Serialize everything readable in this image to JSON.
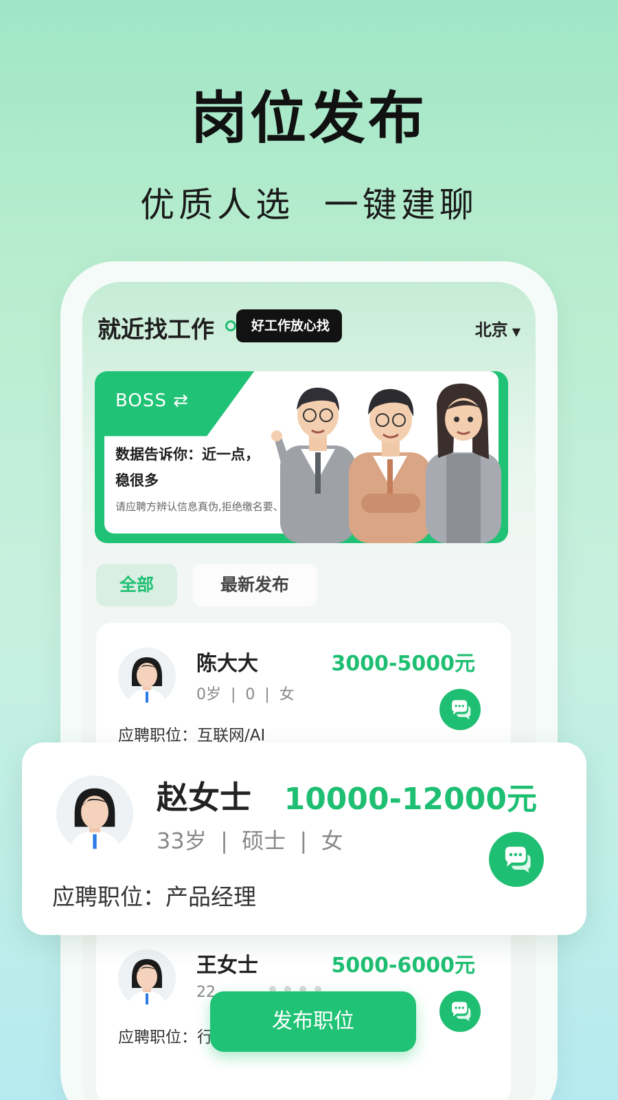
{
  "promo": {
    "headline": "岗位发布",
    "subheadline": "优质人选  一键建聊"
  },
  "app": {
    "title": "就近找工作",
    "slogan": "好工作放心找",
    "city": "北京"
  },
  "banner": {
    "tag": "BOSS ⇄",
    "title": "数据告诉你：近一点，稳很多",
    "note": "请应聘方辨认信息真伪,拒绝缴名要、押金等要求,谨防上当受骗"
  },
  "tabs": [
    {
      "label": "全部",
      "active": true
    },
    {
      "label": "最新发布",
      "active": false
    }
  ],
  "candidates": [
    {
      "name": "陈大大",
      "salary": "3000-5000元",
      "meta": "0岁  |  0  |  女",
      "position": "应聘职位：互联网/AI"
    },
    {
      "name": "赵女士",
      "salary": "10000-12000元",
      "meta": "33岁  |  硕士  |  女",
      "position": "应聘职位：产品经理"
    },
    {
      "name": "王女士",
      "salary": "5000-6000元",
      "meta": "22",
      "position": "应聘职位：行"
    }
  ],
  "actions": {
    "publish": "发布职位"
  },
  "colors": {
    "accent": "#1fbf73",
    "banner": "#20c275",
    "dark_tag": "#121212"
  },
  "icons": {
    "chat": "chat-bubble-icon",
    "caret": "caret-down-icon",
    "avatar": "female-avatar-icon"
  }
}
